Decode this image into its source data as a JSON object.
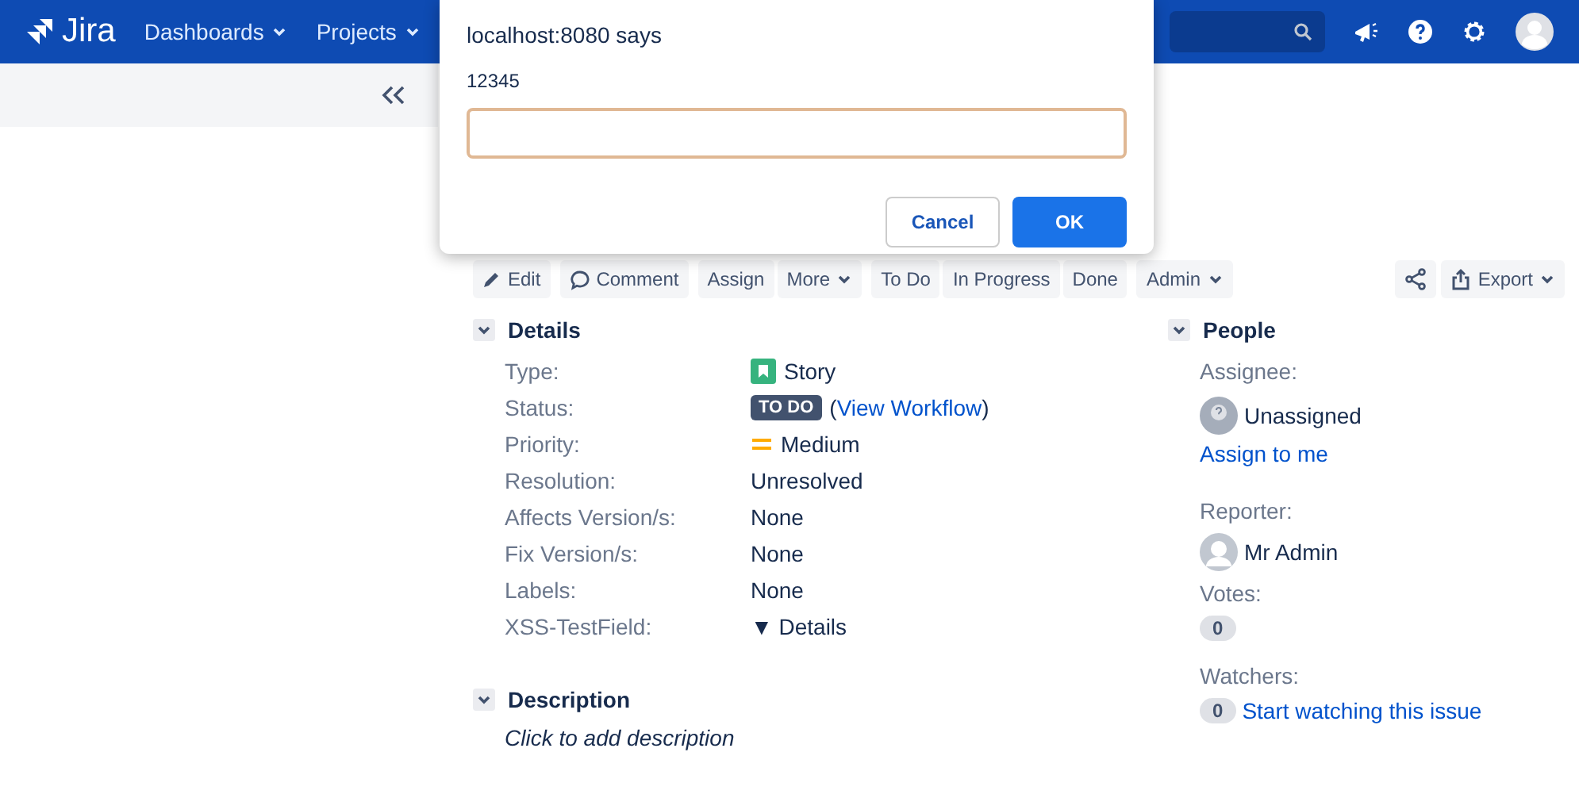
{
  "header": {
    "logo": "Jira",
    "nav": [
      {
        "label": "Dashboards"
      },
      {
        "label": "Projects"
      }
    ]
  },
  "toolbar": {
    "groups": [
      [
        {
          "label": "Edit",
          "kind": "edit"
        }
      ],
      [
        {
          "label": "Comment",
          "kind": "comment"
        }
      ],
      [
        {
          "label": "Assign",
          "kind": "plain"
        },
        {
          "label": "More",
          "kind": "dropdown"
        }
      ],
      [
        {
          "label": "To Do",
          "kind": "plain"
        },
        {
          "label": "In Progress",
          "kind": "plain"
        },
        {
          "label": "Done",
          "kind": "plain"
        }
      ],
      [
        {
          "label": "Admin",
          "kind": "dropdown"
        }
      ]
    ],
    "right": [
      [
        {
          "kind": "share"
        }
      ],
      [
        {
          "label": "Export",
          "kind": "export"
        }
      ]
    ]
  },
  "details": {
    "title": "Details",
    "expanded": true,
    "fields": [
      {
        "label": "Type:",
        "kind": "issuetype",
        "value": "Story"
      },
      {
        "label": "Status:",
        "kind": "status",
        "lozenge": "TO DO",
        "link_prefix": "(",
        "link": "View Workflow",
        "link_suffix": ")"
      },
      {
        "label": "Priority:",
        "kind": "priority",
        "value": "Medium"
      },
      {
        "label": "Resolution:",
        "kind": "text",
        "value": "Unresolved"
      },
      {
        "label": "Affects Version/s:",
        "kind": "text",
        "value": "None"
      },
      {
        "label": "Fix Version/s:",
        "kind": "text",
        "value": "None"
      },
      {
        "label": "Labels:",
        "kind": "text",
        "value": "None"
      },
      {
        "label": "XSS-TestField:",
        "kind": "disclosure",
        "value": "Details",
        "marker": "▼"
      }
    ]
  },
  "description": {
    "title": "Description",
    "expanded": true,
    "placeholder": "Click to add description"
  },
  "people": {
    "title": "People",
    "expanded": true,
    "assignee_label": "Assignee:",
    "assignee": "Unassigned",
    "assign_link": "Assign to me",
    "reporter_label": "Reporter:",
    "reporter": "Mr Admin",
    "votes_label": "Votes:",
    "votes": "0",
    "watchers_label": "Watchers:",
    "watchers": "0",
    "watch_link": "Start watching this issue"
  },
  "dialog": {
    "title": "localhost:8080 says",
    "message": "12345",
    "buttons": [
      {
        "label": "Cancel",
        "kind": "secondary"
      },
      {
        "label": "OK",
        "kind": "primary"
      }
    ]
  }
}
